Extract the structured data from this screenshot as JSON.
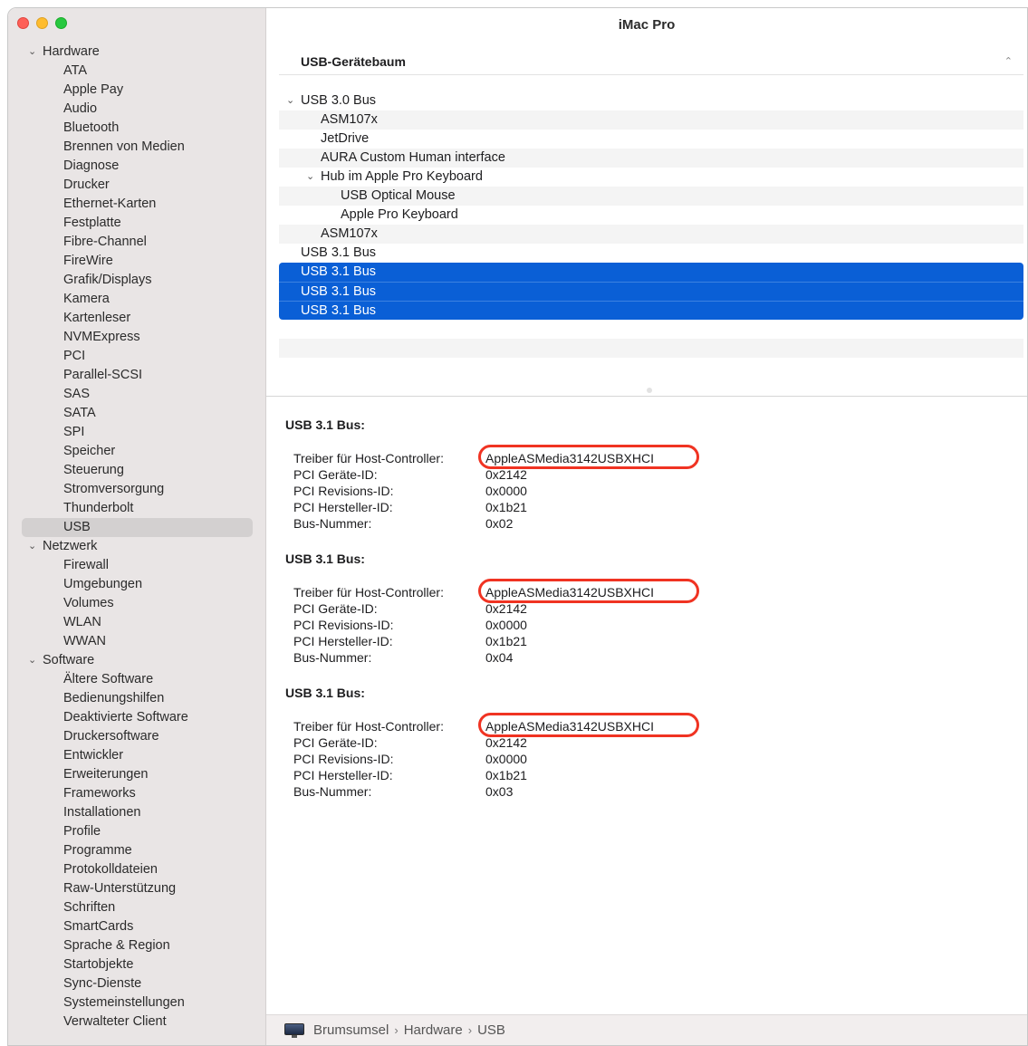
{
  "window": {
    "title": "iMac Pro"
  },
  "sidebar": {
    "rows": [
      {
        "type": "group",
        "label": "Hardware"
      },
      {
        "type": "item",
        "label": "ATA"
      },
      {
        "type": "item",
        "label": "Apple Pay"
      },
      {
        "type": "item",
        "label": "Audio"
      },
      {
        "type": "item",
        "label": "Bluetooth"
      },
      {
        "type": "item",
        "label": "Brennen von Medien"
      },
      {
        "type": "item",
        "label": "Diagnose"
      },
      {
        "type": "item",
        "label": "Drucker"
      },
      {
        "type": "item",
        "label": "Ethernet-Karten"
      },
      {
        "type": "item",
        "label": "Festplatte"
      },
      {
        "type": "item",
        "label": "Fibre-Channel"
      },
      {
        "type": "item",
        "label": "FireWire"
      },
      {
        "type": "item",
        "label": "Grafik/Displays"
      },
      {
        "type": "item",
        "label": "Kamera"
      },
      {
        "type": "item",
        "label": "Kartenleser"
      },
      {
        "type": "item",
        "label": "NVMExpress"
      },
      {
        "type": "item",
        "label": "PCI"
      },
      {
        "type": "item",
        "label": "Parallel-SCSI"
      },
      {
        "type": "item",
        "label": "SAS"
      },
      {
        "type": "item",
        "label": "SATA"
      },
      {
        "type": "item",
        "label": "SPI"
      },
      {
        "type": "item",
        "label": "Speicher"
      },
      {
        "type": "item",
        "label": "Steuerung"
      },
      {
        "type": "item",
        "label": "Stromversorgung"
      },
      {
        "type": "item",
        "label": "Thunderbolt"
      },
      {
        "type": "item",
        "label": "USB",
        "selected": true
      },
      {
        "type": "group",
        "label": "Netzwerk"
      },
      {
        "type": "item",
        "label": "Firewall"
      },
      {
        "type": "item",
        "label": "Umgebungen"
      },
      {
        "type": "item",
        "label": "Volumes"
      },
      {
        "type": "item",
        "label": "WLAN"
      },
      {
        "type": "item",
        "label": "WWAN"
      },
      {
        "type": "group",
        "label": "Software"
      },
      {
        "type": "item",
        "label": "Ältere Software"
      },
      {
        "type": "item",
        "label": "Bedienungshilfen"
      },
      {
        "type": "item",
        "label": "Deaktivierte Software"
      },
      {
        "type": "item",
        "label": "Druckersoftware"
      },
      {
        "type": "item",
        "label": "Entwickler"
      },
      {
        "type": "item",
        "label": "Erweiterungen"
      },
      {
        "type": "item",
        "label": "Frameworks"
      },
      {
        "type": "item",
        "label": "Installationen"
      },
      {
        "type": "item",
        "label": "Profile"
      },
      {
        "type": "item",
        "label": "Programme"
      },
      {
        "type": "item",
        "label": "Protokolldateien"
      },
      {
        "type": "item",
        "label": "Raw-Unterstützung"
      },
      {
        "type": "item",
        "label": "Schriften"
      },
      {
        "type": "item",
        "label": "SmartCards"
      },
      {
        "type": "item",
        "label": "Sprache & Region"
      },
      {
        "type": "item",
        "label": "Startobjekte"
      },
      {
        "type": "item",
        "label": "Sync-Dienste"
      },
      {
        "type": "item",
        "label": "Systemeinstellungen"
      },
      {
        "type": "item",
        "label": "Verwalteter Client"
      }
    ]
  },
  "tree": {
    "header": "USB-Gerätebaum",
    "rows": [
      {
        "label": "USB 3.0 Bus",
        "level": 0,
        "expanded": true
      },
      {
        "label": "ASM107x",
        "level": 1
      },
      {
        "label": "JetDrive",
        "level": 1
      },
      {
        "label": "AURA Custom Human interface",
        "level": 1
      },
      {
        "label": "Hub im Apple Pro Keyboard",
        "level": 1,
        "expanded": true
      },
      {
        "label": "USB Optical Mouse",
        "level": 2
      },
      {
        "label": "Apple Pro Keyboard",
        "level": 2
      },
      {
        "label": "ASM107x",
        "level": 1
      },
      {
        "label": "USB 3.1 Bus",
        "level": 0
      },
      {
        "label": "USB 3.1 Bus",
        "level": 0,
        "selected": true
      },
      {
        "label": "USB 3.1 Bus",
        "level": 0,
        "selected": true
      },
      {
        "label": "USB 3.1 Bus",
        "level": 0,
        "selected": true
      }
    ]
  },
  "details": {
    "buses": [
      {
        "title": "USB 3.1 Bus:",
        "fields": [
          {
            "key": "Treiber für Host-Controller:",
            "value": "AppleASMedia3142USBXHCI"
          },
          {
            "key": "PCI Geräte-ID:",
            "value": "0x2142"
          },
          {
            "key": "PCI Revisions-ID:",
            "value": "0x0000"
          },
          {
            "key": "PCI Hersteller-ID:",
            "value": "0x1b21"
          },
          {
            "key": "Bus-Nummer:",
            "value": "0x02"
          }
        ]
      },
      {
        "title": "USB 3.1 Bus:",
        "fields": [
          {
            "key": "Treiber für Host-Controller:",
            "value": "AppleASMedia3142USBXHCI"
          },
          {
            "key": "PCI Geräte-ID:",
            "value": "0x2142"
          },
          {
            "key": "PCI Revisions-ID:",
            "value": "0x0000"
          },
          {
            "key": "PCI Hersteller-ID:",
            "value": "0x1b21"
          },
          {
            "key": "Bus-Nummer:",
            "value": "0x04"
          }
        ]
      },
      {
        "title": "USB 3.1 Bus:",
        "fields": [
          {
            "key": "Treiber für Host-Controller:",
            "value": "AppleASMedia3142USBXHCI"
          },
          {
            "key": "PCI Geräte-ID:",
            "value": "0x2142"
          },
          {
            "key": "PCI Revisions-ID:",
            "value": "0x0000"
          },
          {
            "key": "PCI Hersteller-ID:",
            "value": "0x1b21"
          },
          {
            "key": "Bus-Nummer:",
            "value": "0x03"
          }
        ]
      }
    ]
  },
  "breadcrumb": {
    "items": [
      "Brumsumsel",
      "Hardware",
      "USB"
    ],
    "separator": "›"
  },
  "icons": {
    "group_chevron": "chevron-down-icon",
    "computer": "imac-icon",
    "highlight": "red-annotation-ring"
  },
  "colors": {
    "selection": "#0a5fd6",
    "annotation": "#f03322",
    "sidebar_bg": "#e9e5e5"
  }
}
